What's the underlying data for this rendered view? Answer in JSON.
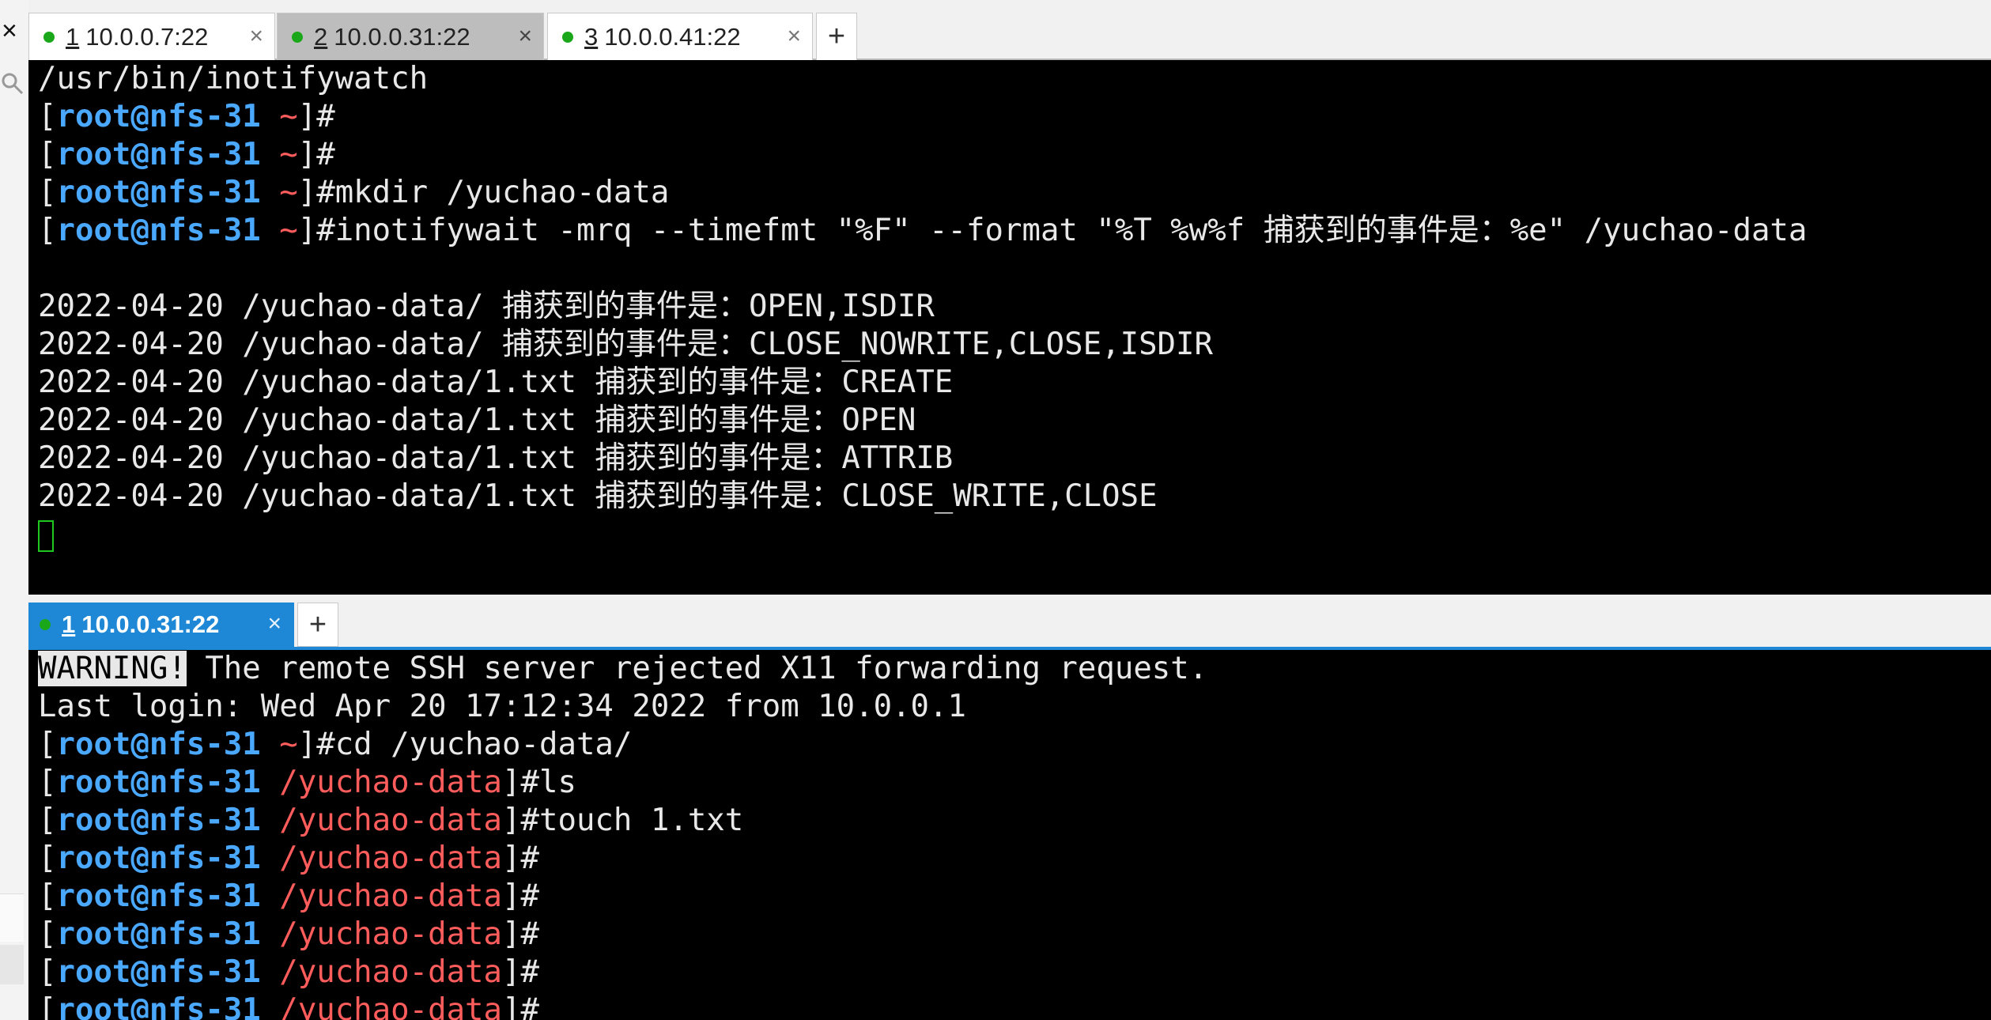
{
  "top_tabs": [
    {
      "num": "1",
      "label": "10.0.0.7:22",
      "active": false
    },
    {
      "num": "2",
      "label": "10.0.0.31:22",
      "active": true
    },
    {
      "num": "3",
      "label": "10.0.0.41:22",
      "active": false
    }
  ],
  "bottom_tabs": [
    {
      "num": "1",
      "label": "10.0.0.31:22",
      "active": true
    }
  ],
  "close_glyph": "×",
  "plus_glyph": "+",
  "prompt": {
    "user_host": "root@nfs-31",
    "home": "~",
    "dir": "/yuchao-data",
    "open": "[",
    "close": "]#"
  },
  "term1": {
    "line0": "/usr/bin/inotifywatch",
    "cmd_mkdir": "mkdir /yuchao-data",
    "cmd_inotify": "inotifywait -mrq --timefmt \"%F\" --format \"%T %w%f 捕获到的事件是：%e\" /yuchao-data",
    "events": [
      "2022-04-20 /yuchao-data/ 捕获到的事件是：OPEN,ISDIR",
      "2022-04-20 /yuchao-data/ 捕获到的事件是：CLOSE_NOWRITE,CLOSE,ISDIR",
      "2022-04-20 /yuchao-data/1.txt 捕获到的事件是：CREATE",
      "2022-04-20 /yuchao-data/1.txt 捕获到的事件是：OPEN",
      "2022-04-20 /yuchao-data/1.txt 捕获到的事件是：ATTRIB",
      "2022-04-20 /yuchao-data/1.txt 捕获到的事件是：CLOSE_WRITE,CLOSE"
    ]
  },
  "term2": {
    "warning_tag": "WARNING!",
    "warning_text": " The remote SSH server rejected X11 forwarding request.",
    "last_login": "Last login: Wed Apr 20 17:12:34 2022 from 10.0.0.1",
    "cmd_cd": "cd /yuchao-data/",
    "cmd_ls": "ls",
    "cmd_touch": "touch 1.txt"
  },
  "colors": {
    "username": "#4aa8ff",
    "path": "#ff5c5c",
    "active_tab": "#1e88d6",
    "status_dot": "#1aa81a"
  }
}
